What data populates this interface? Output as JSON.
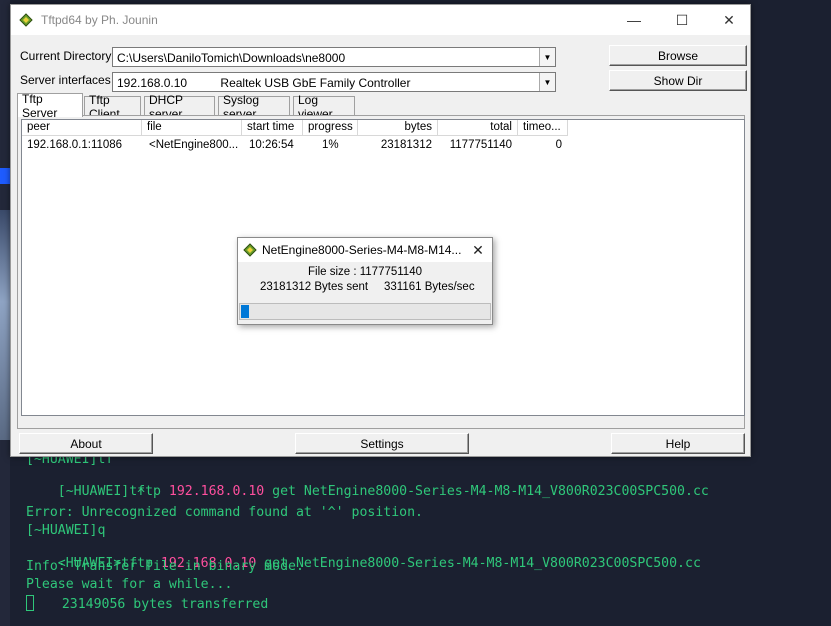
{
  "window": {
    "title": "Tftpd64 by Ph. Jounin",
    "minimize": "—",
    "maximize": "☐",
    "close": "✕"
  },
  "form": {
    "current_directory_label": "Current Directory",
    "current_directory_value": "C:\\Users\\DaniloTomich\\Downloads\\ne8000",
    "server_interfaces_label": "Server interfaces",
    "server_interfaces_value": "192.168.0.10          Realtek USB GbE Family Controller",
    "browse_label": "Browse",
    "show_dir_label": "Show Dir"
  },
  "tabs": [
    {
      "label": "Tftp Server",
      "active": true
    },
    {
      "label": "Tftp Client",
      "active": false
    },
    {
      "label": "DHCP server",
      "active": false
    },
    {
      "label": "Syslog server",
      "active": false
    },
    {
      "label": "Log viewer",
      "active": false
    }
  ],
  "table": {
    "columns": [
      "peer",
      "file",
      "start time",
      "progress",
      "bytes",
      "total",
      "timeo..."
    ],
    "rows": [
      [
        "192.168.0.1:11086",
        "<NetEngine800...",
        "10:26:54",
        "1%",
        "23181312",
        "1177751140",
        "0"
      ]
    ]
  },
  "dialog": {
    "title": "NetEngine8000-Series-M4-M8-M14...",
    "close": "✕",
    "file_size": "File size : 1177751140",
    "bytes_sent": "23181312 Bytes sent",
    "rate": "331161 Bytes/sec",
    "progress_fraction": 0.0197
  },
  "footer": {
    "about_label": "About",
    "settings_label": "Settings",
    "help_label": "Help"
  },
  "terminal": {
    "lines": [
      "[~HUAWEI]tf",
      "[~HUAWEI]tftp 192.168.0.10 get NetEngine8000-Series-M4-M8-M14_V800R023C00SPC500.cc",
      "              ^",
      "Error: Unrecognized command found at '^' position.",
      "[~HUAWEI]q",
      "<HUAWEI>tftp 192.168.0.10 get NetEngine8000-Series-M4-M8-M14_V800R023C00SPC500.cc",
      "Info: Transfer file in binary mode.",
      "Please wait for a while...",
      "23149056 bytes transferred"
    ],
    "highlight": "192.168.0.10"
  },
  "colors": {
    "terminal_bg": "#1b2030",
    "terminal_text": "#2fc77a",
    "ip_highlight": "#ff4f9e",
    "progress": "#0078d7"
  },
  "icons": {
    "app_icon": "tftpd-icon",
    "dialog_icon": "tftpd-icon"
  }
}
